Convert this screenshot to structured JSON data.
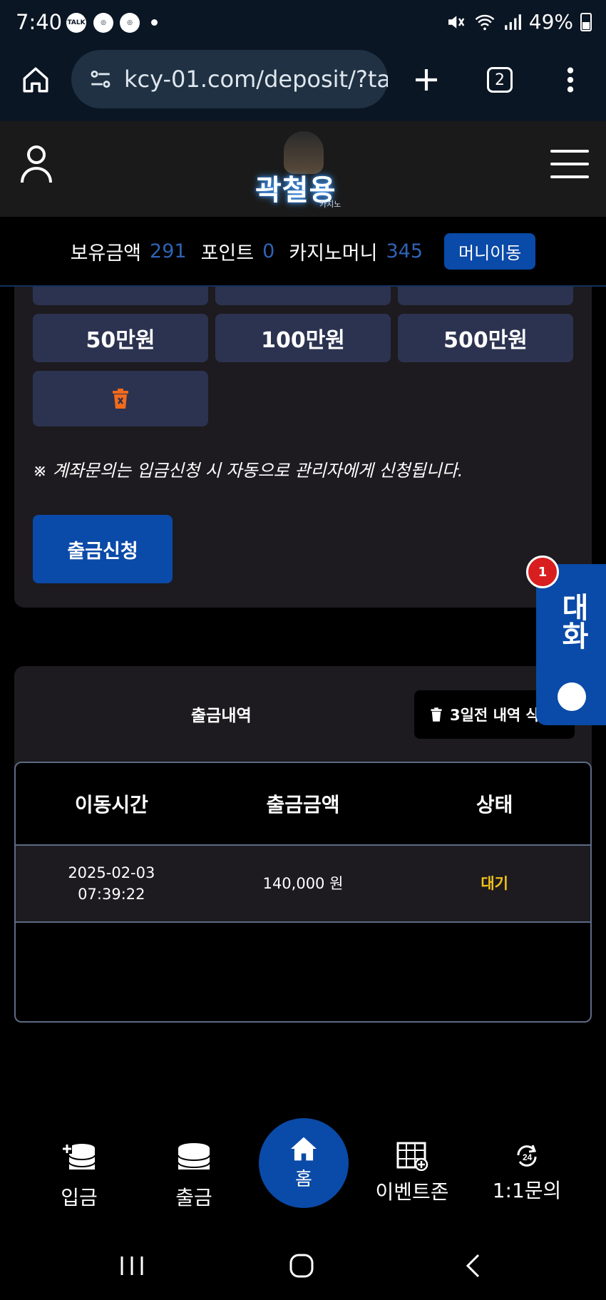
{
  "status_bar": {
    "time": "7:40",
    "notification_icons": [
      "talk-icon",
      "chrome-icon",
      "chrome-icon"
    ],
    "battery": "49%"
  },
  "browser": {
    "url": "kcy-01.com/deposit/?tab",
    "tab_count": "2"
  },
  "header": {
    "logo_text": "곽철용",
    "logo_sub": "카지노"
  },
  "balance": {
    "balance_label": "보유금액",
    "balance_value": "291",
    "point_label": "포인트",
    "point_value": "0",
    "casino_label": "카지노머니",
    "casino_value": "345",
    "move_button": "머니이동"
  },
  "amounts": {
    "row": [
      "50만원",
      "100만원",
      "500만원"
    ]
  },
  "notice": "※ 계좌문의는 입금신청 시 자동으로 관리자에게 신청됩니다.",
  "withdraw_button": "출금신청",
  "history": {
    "title": "출금내역",
    "delete_button": "3일전 내역 삭제",
    "columns": [
      "이동시간",
      "출금금액",
      "상태"
    ],
    "rows": [
      {
        "date": "2025-02-03",
        "time": "07:39:22",
        "amount": "140,000 원",
        "status": "대기"
      }
    ]
  },
  "chat": {
    "label": "대화",
    "badge": "1"
  },
  "bottom_nav": {
    "deposit": "입금",
    "withdraw": "출금",
    "home": "홈",
    "event": "이벤트존",
    "inquiry": "1:1문의"
  },
  "colors": {
    "accent_blue": "#0a4aa8",
    "value_blue": "#2f63b5",
    "status_yellow": "#f1c21b",
    "button_bg": "#2c3350",
    "panel_bg": "#1d1b1f"
  }
}
